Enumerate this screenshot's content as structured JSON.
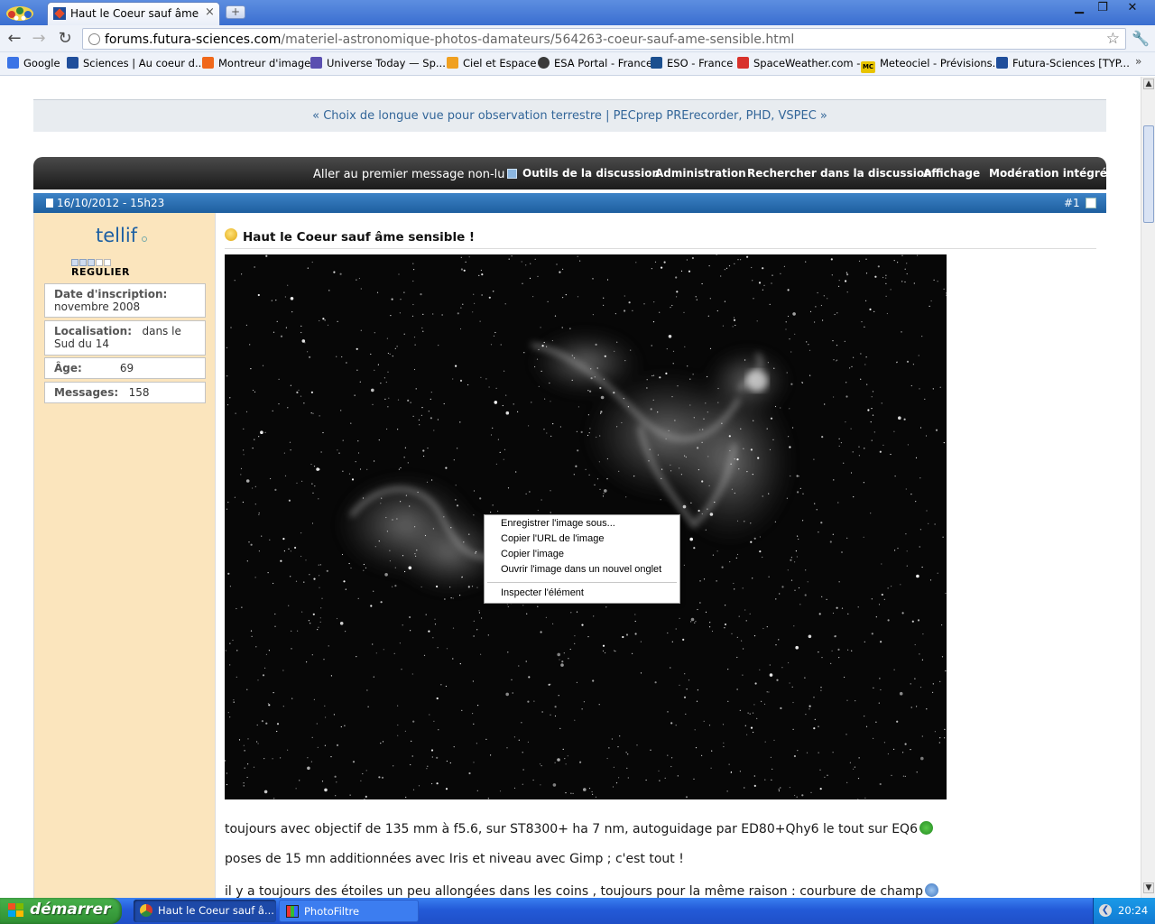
{
  "browser": {
    "tab_title": "Haut le Coeur sauf âme sensible",
    "tab_close": "×",
    "new_tab": "+",
    "url_host": "forums.futura-sciences.com",
    "url_path": "/materiel-astronomique-photos-damateurs/564263-coeur-sauf-ame-sensible.html",
    "window_controls": {
      "minimize": "▁",
      "maximize": "❐",
      "close": "✕"
    },
    "nav_icons": {
      "back": "back-arrow-icon",
      "forward": "forward-arrow-icon",
      "reload": "reload-icon",
      "star": "star-icon",
      "wrench": "wrench-icon"
    },
    "bookmarks": [
      {
        "label": "Google",
        "icon_color": "#3b74e6"
      },
      {
        "label": "Sciences | Au coeur d...",
        "icon_color": "#1f4e9b"
      },
      {
        "label": "Montreur d'images",
        "icon_color": "#f0681a"
      },
      {
        "label": "Universe Today — Sp...",
        "icon_color": "#5a4fb0"
      },
      {
        "label": "Ciel et Espace",
        "icon_color": "#f0a020"
      },
      {
        "label": "ESA Portal - France",
        "icon_color": "#3a3a3a"
      },
      {
        "label": "ESO - France",
        "icon_color": "#1b4f8f"
      },
      {
        "label": "SpaceWeather.com --",
        "icon_color": "#d8322b"
      },
      {
        "label": "Meteociel - Prévisions...",
        "icon_color": "#e8c400",
        "icon_text": "MC"
      },
      {
        "label": "Futura-Sciences [TYP...",
        "icon_color": "#1f4e9b"
      }
    ],
    "bookmarks_more": "»"
  },
  "thread_nav": {
    "prev_label": "« Choix de longue vue pour observation terrestre",
    "separator": "|",
    "next_label": "PECprep PRErecorder, PHD, VSPEC »"
  },
  "toolbar": {
    "unread": "Aller au premier message non-lu",
    "items": [
      "Outils de la discussion",
      "Administration",
      "Rechercher dans la discussion",
      "Affichage",
      "Modération intégrée"
    ]
  },
  "post": {
    "date": "16/10/2012 - 15h23",
    "number": "#1",
    "title": "Haut le Coeur sauf âme sensible !",
    "lines": [
      "toujours avec objectif de 135 mm à f5.6, sur ST8300+ ha 7 nm, autoguidage par ED80+Qhy6 le tout sur EQ6",
      "poses de 15 mn additionnées avec Iris et niveau avec Gimp ; c'est tout !",
      "il y a toujours des étoiles un peu allongées dans les coins , toujours pour la même raison : courbure de champ"
    ]
  },
  "user": {
    "name": "tellif",
    "rank": "REGULIER",
    "rank_filled": 3,
    "rank_total": 5,
    "join_label": "Date d'inscription:",
    "join_value": "novembre 2008",
    "location_label": "Localisation:",
    "location_value": "dans le",
    "location_value_2": "Sud du 14",
    "age_label": "Âge:",
    "age_value": "69",
    "messages_label": "Messages:",
    "messages_value": "158"
  },
  "context_menu": {
    "items": [
      "Enregistrer l'image sous...",
      "Copier l'URL de l'image",
      "Copier l'image",
      "Ouvrir l'image dans un nouvel onglet"
    ],
    "inspect": "Inspecter l'élément"
  },
  "taskbar": {
    "start_label": "démarrer",
    "tasks": [
      "Haut le Coeur sauf â...",
      "PhotoFiltre"
    ],
    "clock": "20:24"
  }
}
